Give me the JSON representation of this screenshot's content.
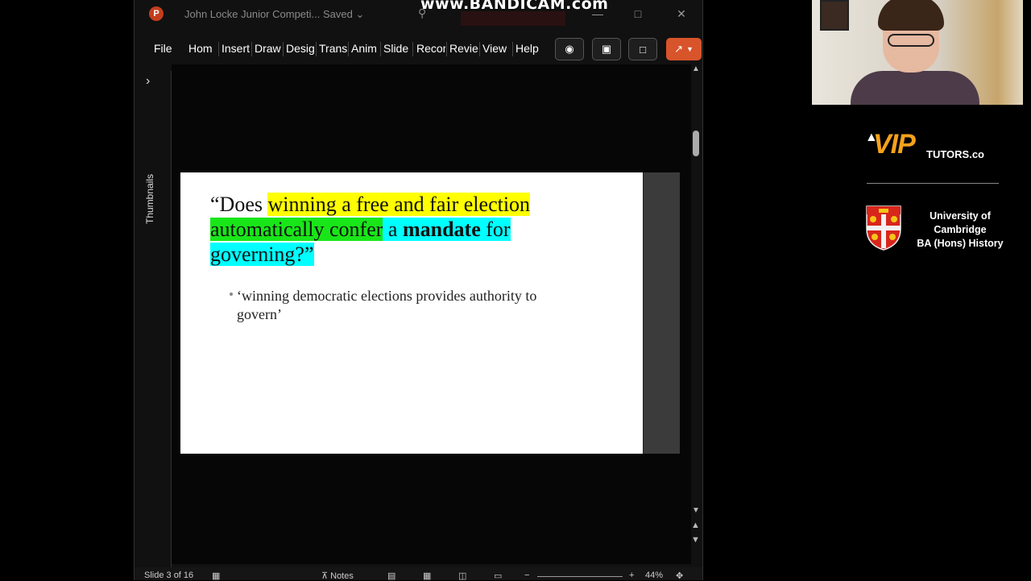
{
  "window": {
    "app_icon": "P",
    "doc_title": "John Locke Junior Competi...",
    "save_status": "Saved",
    "watermark": "www.BANDICAM.com"
  },
  "ribbon": {
    "tabs": [
      "File",
      "Home",
      "Insert",
      "Draw",
      "Design",
      "Transitions",
      "Animations",
      "Slide Show",
      "Record",
      "Review",
      "View",
      "Help"
    ],
    "tab_display": [
      "File",
      "Hom ",
      "Insert",
      "Draw",
      "Desig",
      "Transi",
      "Anim",
      "Slide",
      "Recor",
      "Revie",
      "View",
      "Help"
    ]
  },
  "sidebar": {
    "label": "Thumbnails"
  },
  "slide": {
    "title_open": "“Does ",
    "title_hl1": "winning a free and fair election",
    "title_hl2": "automatically confer",
    "title_hl3a": " a ",
    "title_hl3b": "mandate",
    "title_hl3c": " for",
    "title_hl4": "governing?”",
    "bullet": "‘winning democratic elections provides authority to govern’"
  },
  "status": {
    "slide_counter": "Slide 3 of 16",
    "notes": "Notes",
    "zoom": "44%"
  },
  "branding": {
    "vip": "VIP",
    "tutors": "TUTORS.co",
    "uni_line1": "University of",
    "uni_line2": "Cambridge",
    "uni_line3": "BA (Hons) History",
    "accent": "#f5a21a"
  },
  "colors": {
    "highlight_yellow": "#ffff00",
    "highlight_green": "#19e619",
    "highlight_cyan": "#00ffff",
    "share_button": "#d8542a"
  }
}
